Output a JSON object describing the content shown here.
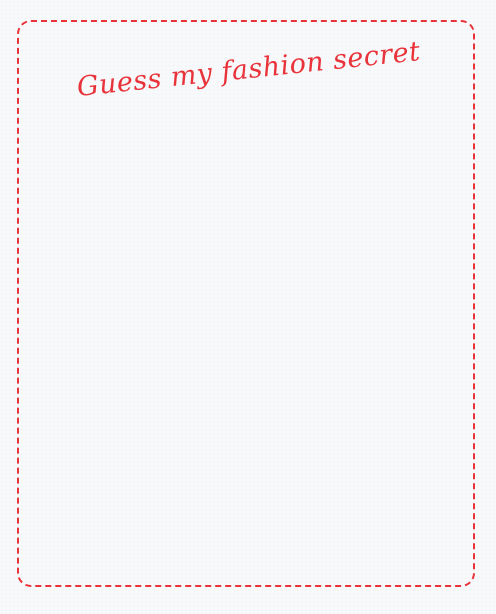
{
  "card": {
    "title": "Guess my fashion secret"
  },
  "colors": {
    "accent": "#e8333a",
    "background": "#f8f9fb"
  }
}
